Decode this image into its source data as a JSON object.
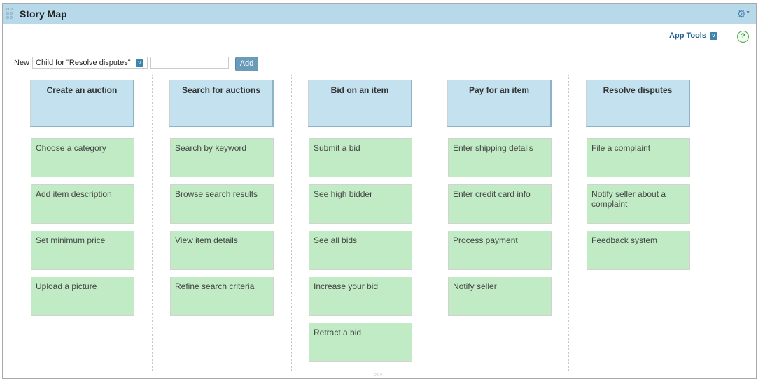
{
  "header": {
    "title": "Story Map",
    "grip_icon": "drag-handle-icon",
    "settings_icon": "gear-icon"
  },
  "toolbar": {
    "app_tools_label": "App Tools",
    "help_label": "?",
    "new_label": "New",
    "new_type_selected": "Child for \"Resolve disputes\"",
    "new_name_value": "",
    "add_label": "Add"
  },
  "columns": [
    {
      "title": "Create an auction",
      "stories": [
        "Choose a category",
        "Add item description",
        "Set minimum price",
        "Upload a picture"
      ]
    },
    {
      "title": "Search for auctions",
      "stories": [
        "Search by keyword",
        "Browse search results",
        "View item details",
        "Refine search criteria"
      ]
    },
    {
      "title": "Bid on an item",
      "stories": [
        "Submit a bid",
        "See high bidder",
        "See all bids",
        "Increase your bid",
        "Retract a bid"
      ]
    },
    {
      "title": "Pay for an item",
      "stories": [
        "Enter shipping details",
        "Enter credit card info",
        "Process payment",
        "Notify seller"
      ]
    },
    {
      "title": "Resolve disputes",
      "stories": [
        "File a complaint",
        "Notify seller about a complaint",
        "Feedback system"
      ]
    }
  ],
  "colors": {
    "titlebar": "#b7d9ea",
    "epic_card": "#c3e1ef",
    "story_card": "#c0ebc5",
    "accent": "#3e84ad"
  }
}
